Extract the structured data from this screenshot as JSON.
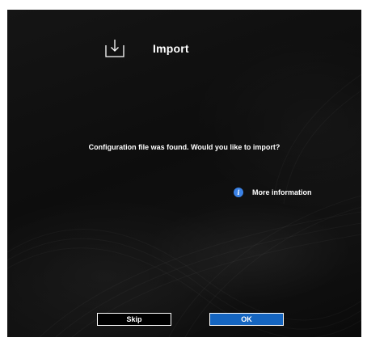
{
  "dialog": {
    "icon": "import-icon",
    "title": "Import",
    "message": "Configuration file was found. Would you like to import?",
    "more_info": {
      "icon": "info-icon",
      "label": "More information"
    }
  },
  "buttons": {
    "skip_label": "Skip",
    "ok_label": "OK"
  },
  "colors": {
    "background": "#0f0f0f",
    "text": "#ffffff",
    "accent": "#1565c0",
    "info": "#3b82e6"
  }
}
